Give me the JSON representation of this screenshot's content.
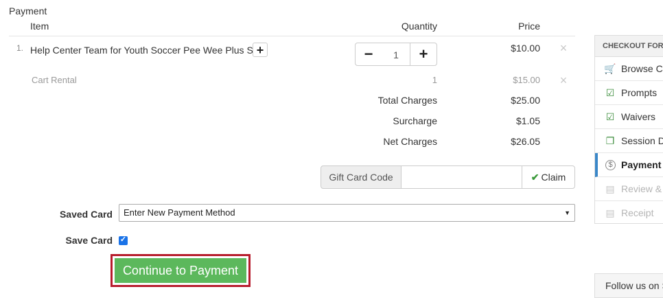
{
  "section_title": "Payment",
  "table": {
    "headers": {
      "item": "Item",
      "quantity": "Quantity",
      "price": "Price"
    },
    "rows": [
      {
        "index": "1.",
        "name": "Help Center Team for Youth Soccer Pee Wee Plus Sat",
        "add_icon": "+",
        "quantity": "1",
        "minus_label": "−",
        "plus_label": "+",
        "price": "$10.00",
        "remove_icon": "×"
      },
      {
        "name": "Cart Rental",
        "quantity": "1",
        "price": "$15.00",
        "remove_icon": "×"
      }
    ]
  },
  "summary": {
    "total_label": "Total Charges",
    "total_value": "$25.00",
    "surcharge_label": "Surcharge",
    "surcharge_value": "$1.05",
    "net_label": "Net Charges",
    "net_value": "$26.05"
  },
  "gift_card": {
    "label": "Gift Card Code",
    "value": "",
    "claim_label": "Claim",
    "check_icon": "✔"
  },
  "saved_card": {
    "label": "Saved Card",
    "selected": "Enter New Payment Method",
    "arrow": "▼"
  },
  "save_card": {
    "label": "Save Card",
    "checked": true,
    "check": "✓"
  },
  "continue_button": {
    "label": "Continue to Payment",
    "color": "#5cb85c",
    "outline_color": "#b71c2c"
  },
  "sidebar": {
    "header": "CHECKOUT FOR",
    "items": [
      {
        "label": "Browse Ca",
        "icon": "cart-icon",
        "glyph": "🛒",
        "state": "done"
      },
      {
        "label": "Prompts",
        "icon": "checklist-icon",
        "glyph": "☑",
        "state": "done"
      },
      {
        "label": "Waivers",
        "icon": "checklist-icon",
        "glyph": "☑",
        "state": "done"
      },
      {
        "label": "Session De",
        "icon": "documents-icon",
        "glyph": "❐",
        "state": "done"
      },
      {
        "label": "Payment",
        "icon": "dollar-circle-icon",
        "glyph": "$",
        "state": "active"
      },
      {
        "label": "Review & C",
        "icon": "list-icon",
        "glyph": "▤",
        "state": "pending"
      },
      {
        "label": "Receipt",
        "icon": "receipt-icon",
        "glyph": "▤",
        "state": "pending"
      }
    ],
    "active_color": "#3a87c8",
    "done_icon_color": "#3b8d3b"
  },
  "follow": {
    "label": "Follow us on S"
  }
}
